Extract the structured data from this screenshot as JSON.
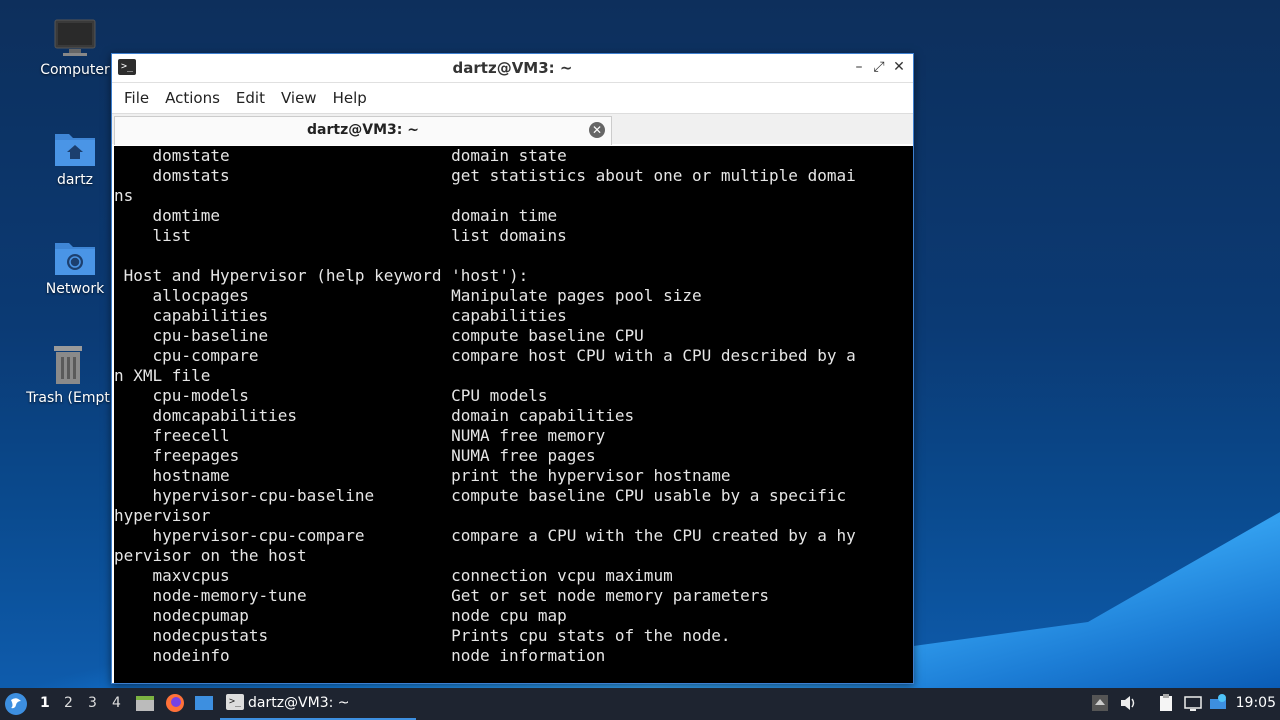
{
  "desktop": {
    "icons": [
      {
        "label": "Computer",
        "icon": "computer-icon"
      },
      {
        "label": "dartz",
        "icon": "home-folder-icon"
      },
      {
        "label": "Network",
        "icon": "network-folder-icon"
      },
      {
        "label": "Trash (Empt",
        "icon": "trash-icon"
      }
    ]
  },
  "window": {
    "title": "dartz@VM3: ~",
    "menu": [
      "File",
      "Actions",
      "Edit",
      "View",
      "Help"
    ],
    "tab_label": "dartz@VM3: ~",
    "terminal_lines": [
      "    domstate                       domain state",
      "    domstats                       get statistics about one or multiple domai",
      "ns",
      "    domtime                        domain time",
      "    list                           list domains",
      "",
      " Host and Hypervisor (help keyword 'host'):",
      "    allocpages                     Manipulate pages pool size",
      "    capabilities                   capabilities",
      "    cpu-baseline                   compute baseline CPU",
      "    cpu-compare                    compare host CPU with a CPU described by a",
      "n XML file",
      "    cpu-models                     CPU models",
      "    domcapabilities                domain capabilities",
      "    freecell                       NUMA free memory",
      "    freepages                      NUMA free pages",
      "    hostname                       print the hypervisor hostname",
      "    hypervisor-cpu-baseline        compute baseline CPU usable by a specific",
      "hypervisor",
      "    hypervisor-cpu-compare         compare a CPU with the CPU created by a hy",
      "pervisor on the host",
      "    maxvcpus                       connection vcpu maximum",
      "    node-memory-tune               Get or set node memory parameters",
      "    nodecpumap                     node cpu map",
      "    nodecpustats                   Prints cpu stats of the node.",
      "    nodeinfo                       node information"
    ]
  },
  "taskbar": {
    "workspaces": [
      "1",
      "2",
      "3",
      "4"
    ],
    "active_workspace": "1",
    "task_label": "dartz@VM3: ~",
    "clock": "19:05"
  }
}
